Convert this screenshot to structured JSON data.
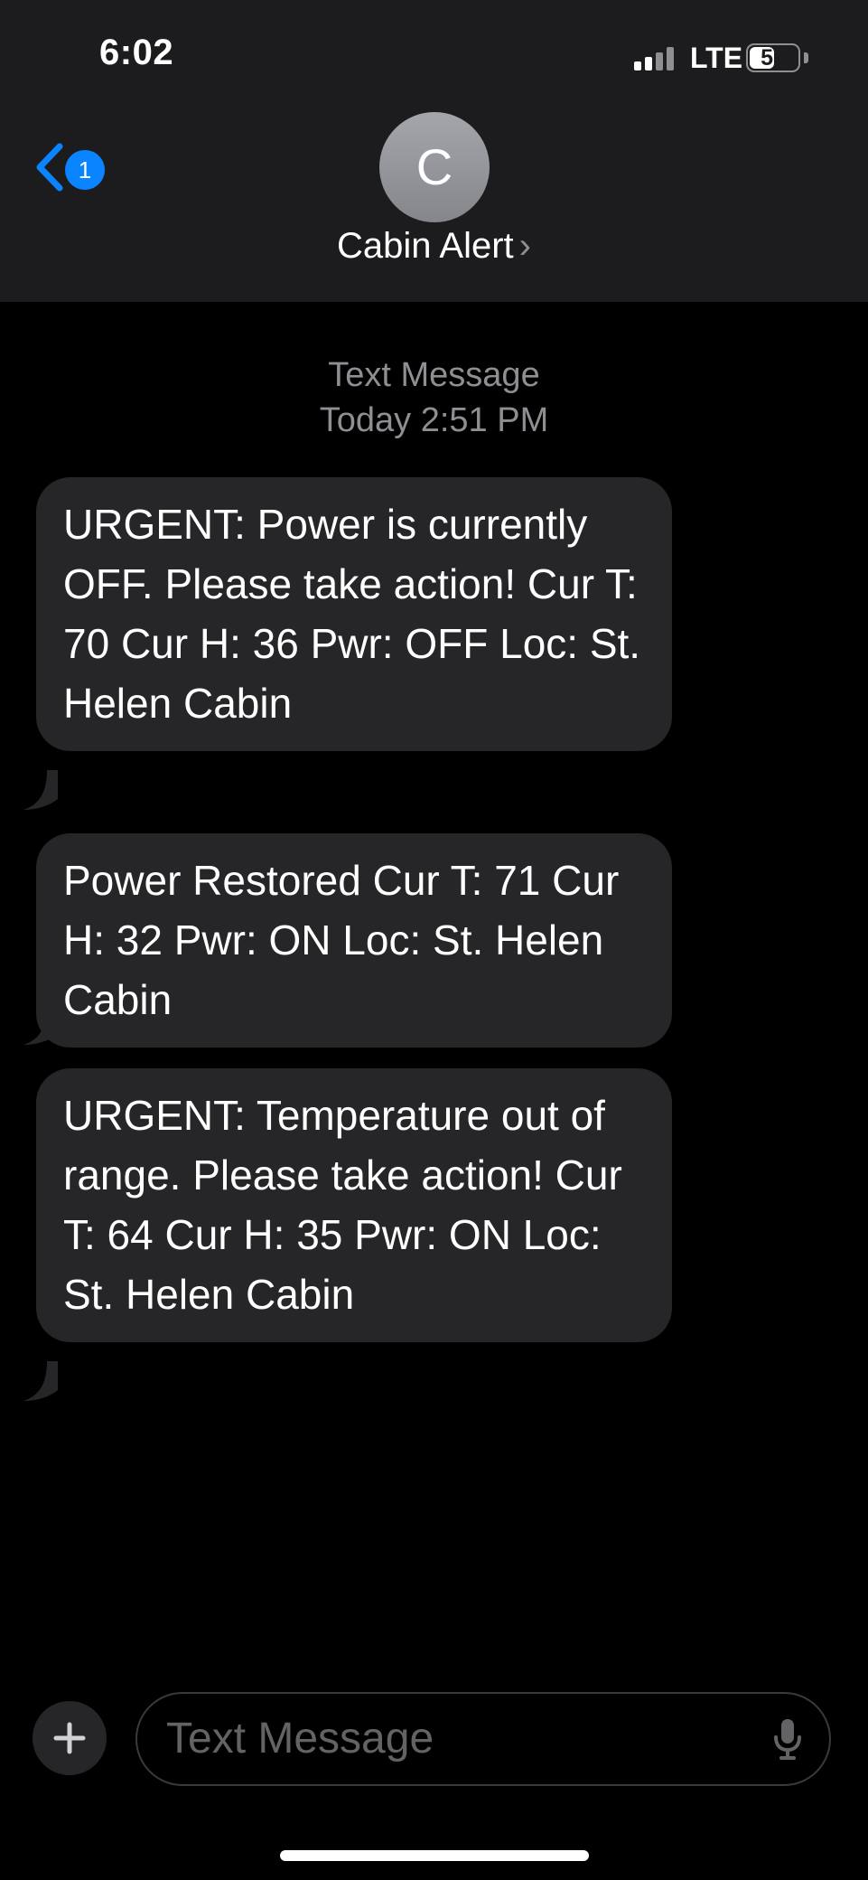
{
  "status_bar": {
    "time": "6:02",
    "network": "LTE",
    "battery": "55",
    "battery_level_percent": 55
  },
  "header": {
    "back_badge_count": "1",
    "avatar_initial": "C",
    "contact_name": "Cabin Alert",
    "contact_chevron": "›"
  },
  "thread": {
    "service_label": "Text Message",
    "timestamp": "Today 2:51 PM",
    "messages": [
      {
        "text": "URGENT: Power is currently OFF. Please take action! Cur T: 70 Cur H: 36 Pwr: OFF Loc: St. Helen Cabin"
      },
      {
        "text": "Power Restored Cur T: 71 Cur H: 32 Pwr: ON Loc: St. Helen Cabin"
      },
      {
        "text": "URGENT: Temperature out of range. Please take action! Cur T: 64 Cur H: 35 Pwr: ON Loc: St. Helen Cabin"
      }
    ]
  },
  "composer": {
    "placeholder": "Text Message"
  },
  "icons": {
    "back": "chevron-left-icon",
    "plus": "plus-icon",
    "mic": "microphone-icon",
    "signal": "cellular-signal-icon",
    "battery": "battery-icon"
  },
  "colors": {
    "accent": "#0a84ff",
    "header_background": "#1c1c1e",
    "bubble_background": "#262628",
    "secondary_text": "#8e8e93",
    "placeholder_text": "#636366"
  }
}
